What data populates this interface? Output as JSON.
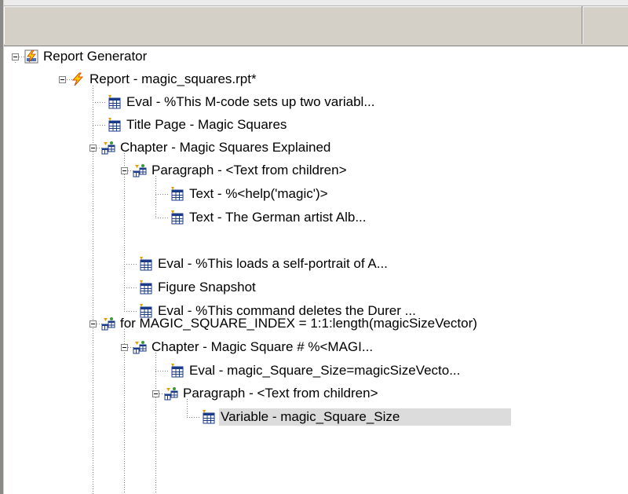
{
  "tree": {
    "nodes": [
      {
        "label": "Report Generator",
        "icon": "report-generator-icon"
      },
      {
        "label": "Report - magic_squares.rpt*",
        "icon": "report-icon"
      },
      {
        "label": "Eval - %This M-code sets up two variabl...",
        "icon": "component-icon"
      },
      {
        "label": "Title Page - Magic Squares",
        "icon": "component-icon"
      },
      {
        "label": "Chapter - Magic Squares Explained",
        "icon": "component-parent-icon"
      },
      {
        "label": "Paragraph - <Text from children>",
        "icon": "component-parent-icon"
      },
      {
        "label": "Text - %<help('magic')>",
        "icon": "component-icon"
      },
      {
        "label": "Text - The German artist Alb...",
        "icon": "component-icon"
      },
      {
        "label": "Eval - %This loads a self-portrait of A...",
        "icon": "component-icon"
      },
      {
        "label": "Figure Snapshot",
        "icon": "component-icon"
      },
      {
        "label": "Eval - %This command deletes the Durer ...",
        "icon": "component-icon"
      },
      {
        "label": "for MAGIC_SQUARE_INDEX = 1:1:length(magicSizeVector)",
        "icon": "component-parent-icon"
      },
      {
        "label": "Chapter - Magic Square # %<MAGI...",
        "icon": "component-parent-icon"
      },
      {
        "label": "Eval - magic_Square_Size=magicSizeVecto...",
        "icon": "component-icon"
      },
      {
        "label": "Paragraph - <Text from children>",
        "icon": "component-parent-icon"
      },
      {
        "label": "Variable - magic_Square_Size",
        "icon": "component-icon",
        "selected": true
      }
    ]
  },
  "colors": {
    "selection_bg": "#dcdcdc",
    "header_bg": "#d4d0c8",
    "tree_lines": "#808080"
  }
}
